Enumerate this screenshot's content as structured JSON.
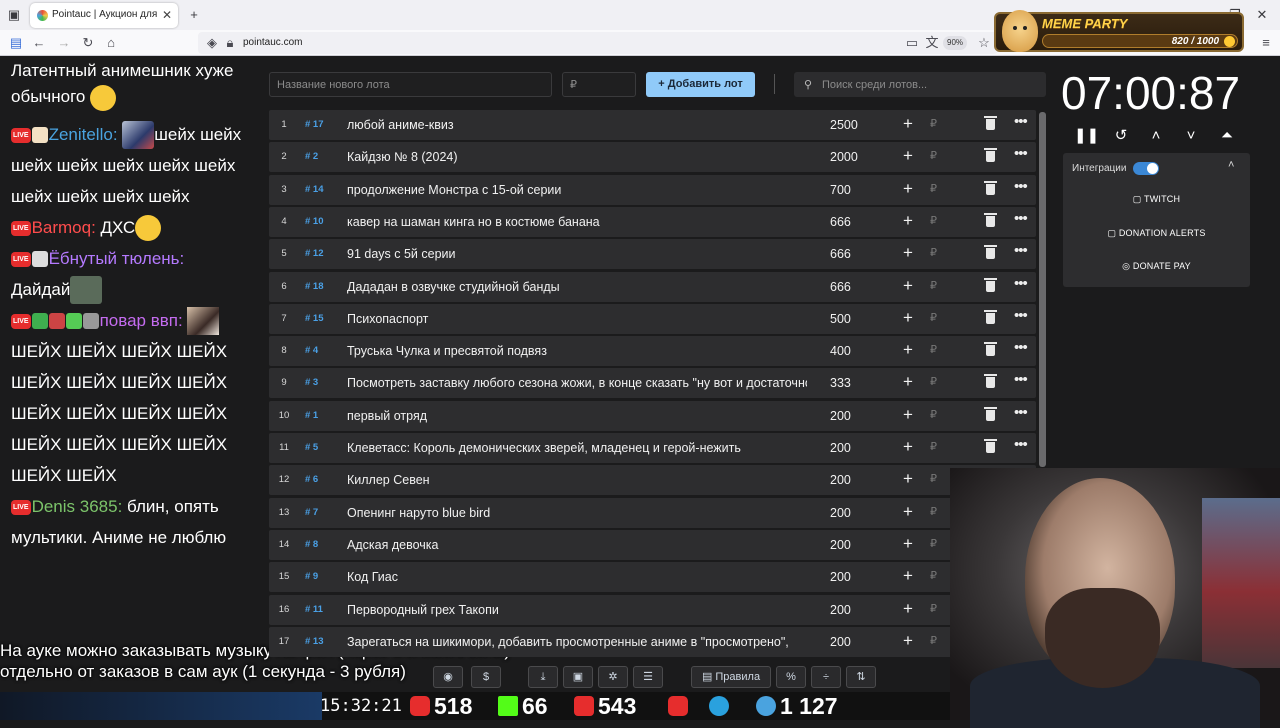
{
  "browser": {
    "tab_title": "Pointauc | Аукцион для стримеров",
    "url": "pointauc.com",
    "zoom": "90%"
  },
  "extension_banner": {
    "title": "MEME PARTY",
    "progress": "820 / 1000"
  },
  "chat": {
    "messages": [
      {
        "text": "Латентный анимешник хуже обычного"
      },
      {
        "user": "Zenitello:",
        "user_color": "#4aa3df",
        "text": "шейх шейх шейх шейх шейх шейх шейх шейх шейх шейх шейх"
      },
      {
        "user": "Barmoq:",
        "user_color": "#ff4d4d",
        "text": "ДХС"
      },
      {
        "user": "Ёбнутый тюлень:",
        "user_color": "#b57aff",
        "text": "Дайдай"
      },
      {
        "user": "повар ввп:",
        "user_color": "#c56cf0",
        "text": "ШЕЙХ ШЕЙХ ШЕЙХ ШЕЙХ ШЕЙХ ШЕЙХ ШЕЙХ ШЕЙХ ШЕЙХ ШЕЙХ ШЕЙХ ШЕЙХ ШЕЙХ ШЕЙХ ШЕЙХ ШЕЙХ ШЕЙХ ШЕЙХ"
      },
      {
        "user": "Denis 3685:",
        "user_color": "#7cc46a",
        "text": "блин, опять мультики. Аниме не люблю"
      }
    ]
  },
  "overlay_text": "На ауке можно заказывать музыку на фон (через DonationAlerts) отдельно от заказов в сам аук (1 секунда - 3 рубля)",
  "stats": {
    "clock": "15:32:21",
    "youtube": "518",
    "kick": "66",
    "live": "543",
    "telegram_sep": "",
    "viewers": "1 127"
  },
  "controls": {
    "lot_name_placeholder": "Название нового лота",
    "amount_placeholder": "₽",
    "add_lot_label": "Добавить лот",
    "search_placeholder": "Поиск среди лотов..."
  },
  "lots": [
    {
      "n": "1",
      "id": "# 17",
      "name": "любой аниме-квиз",
      "amount": "2500"
    },
    {
      "n": "2",
      "id": "# 2",
      "name": "Кайдзю № 8 (2024)",
      "amount": "2000"
    },
    {
      "n": "3",
      "id": "# 14",
      "name": "продолжение Монстра с 15-ой серии",
      "amount": "700"
    },
    {
      "n": "4",
      "id": "# 10",
      "name": "кавер на шаман кинга но в костюме банана",
      "amount": "666"
    },
    {
      "n": "5",
      "id": "# 12",
      "name": "91 days с 5й серии",
      "amount": "666"
    },
    {
      "n": "6",
      "id": "# 18",
      "name": "Дададан в озвучке студийной банды",
      "amount": "666"
    },
    {
      "n": "7",
      "id": "# 15",
      "name": "Психопаспорт",
      "amount": "500"
    },
    {
      "n": "8",
      "id": "# 4",
      "name": "Труська Чулка и пресвятой подвяз",
      "amount": "400"
    },
    {
      "n": "9",
      "id": "# 3",
      "name": "Посмотреть заставку любого сезона жожи, в конце сказать \"ну вот и достаточно\"",
      "amount": "333"
    },
    {
      "n": "10",
      "id": "# 1",
      "name": "первый отряд",
      "amount": "200"
    },
    {
      "n": "11",
      "id": "# 5",
      "name": "Клеветасс: Король демонических зверей, младенец и герой-нежить",
      "amount": "200"
    },
    {
      "n": "12",
      "id": "# 6",
      "name": "Киллер Севен",
      "amount": "200"
    },
    {
      "n": "13",
      "id": "# 7",
      "name": "Опенинг наруто blue bird",
      "amount": "200"
    },
    {
      "n": "14",
      "id": "# 8",
      "name": "Адская девочка",
      "amount": "200"
    },
    {
      "n": "15",
      "id": "# 9",
      "name": "Код Гиас",
      "amount": "200"
    },
    {
      "n": "16",
      "id": "# 11",
      "name": "Первородный грех Такопи",
      "amount": "200"
    },
    {
      "n": "17",
      "id": "# 13",
      "name": "Зарегаться на шикимори, добавить просмотренные аниме в \"просмотрено\",",
      "amount": "200"
    }
  ],
  "toolbar": {
    "rules_label": "Правила"
  },
  "timer": {
    "value": "07:00:87"
  },
  "integrations": {
    "label": "Интеграции",
    "twitch": "TWITCH",
    "donation_alerts": "DONATION ALERTS",
    "donate_pay": "DONATE PAY",
    "colors": {
      "twitch": "#7b3fe4",
      "donation_alerts": "#f07d1f",
      "donate_pay": "#3fae4f"
    }
  }
}
